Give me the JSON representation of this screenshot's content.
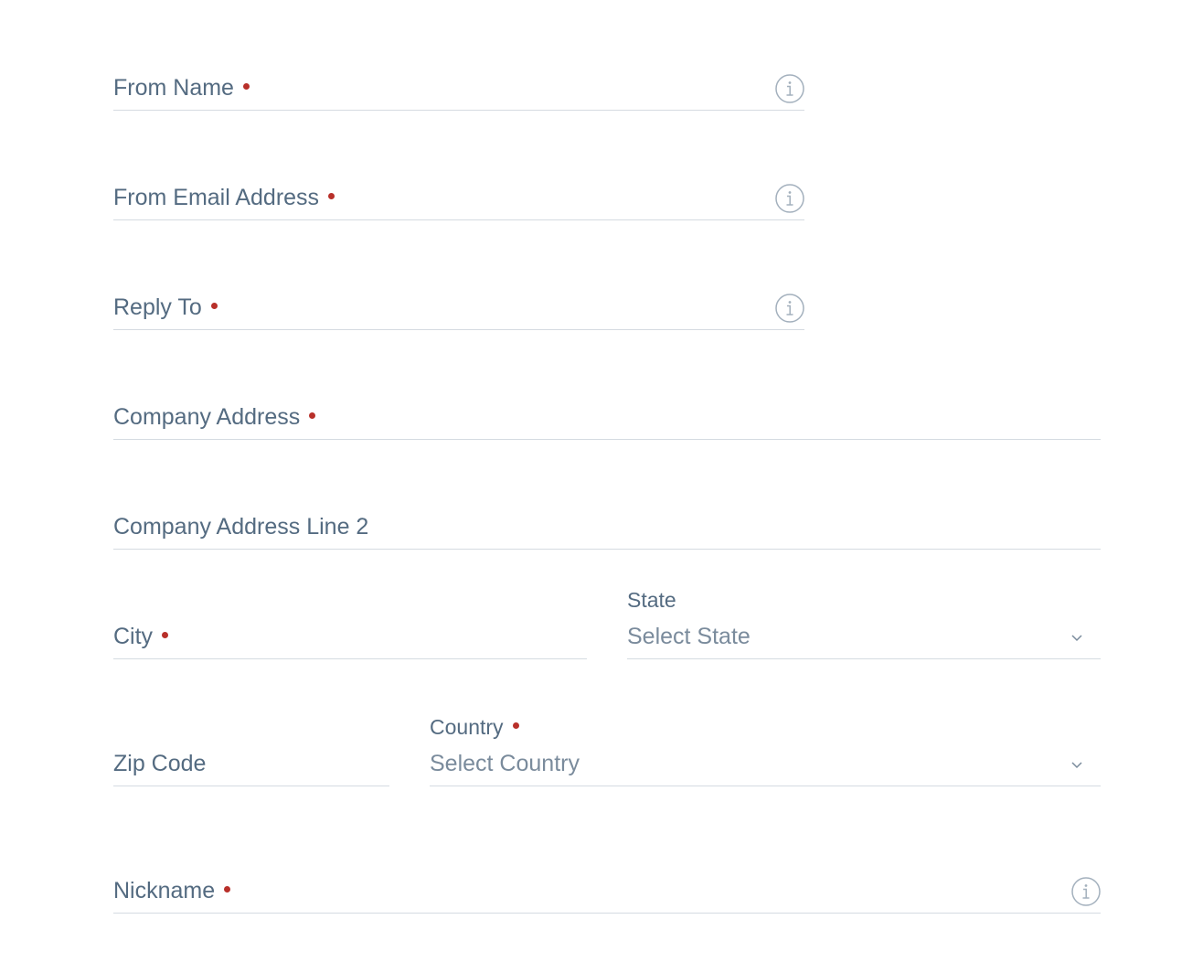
{
  "form": {
    "from_name": {
      "label": "From Name",
      "required": true,
      "value": ""
    },
    "from_email": {
      "label": "From Email Address",
      "required": true,
      "value": ""
    },
    "reply_to": {
      "label": "Reply To",
      "required": true,
      "value": ""
    },
    "company_address": {
      "label": "Company Address",
      "required": true,
      "value": ""
    },
    "company_address_2": {
      "label": "Company Address Line 2",
      "required": false,
      "value": ""
    },
    "city": {
      "label": "City",
      "required": true,
      "value": ""
    },
    "state": {
      "label": "State",
      "required": false,
      "selected": "Select State"
    },
    "zip": {
      "label": "Zip Code",
      "required": false,
      "value": ""
    },
    "country": {
      "label": "Country",
      "required": true,
      "selected": "Select Country"
    },
    "nickname": {
      "label": "Nickname",
      "required": true,
      "value": ""
    }
  },
  "icons": {
    "info": "info-circle-icon",
    "chevron": "chevron-down-icon"
  },
  "colors": {
    "label": "#546b81",
    "required_dot": "#b8302a",
    "underline": "#d5dbe1",
    "icon": "#a3b0bd"
  }
}
